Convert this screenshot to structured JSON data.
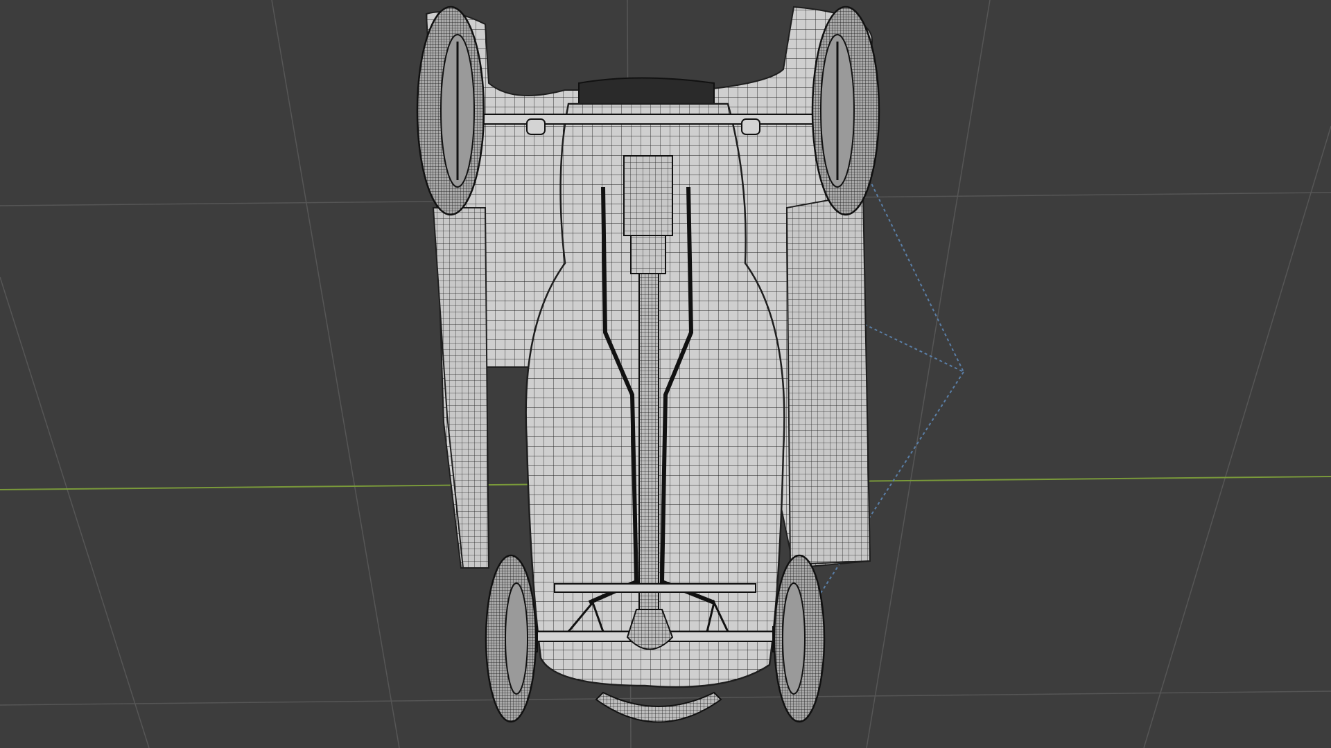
{
  "app": {
    "name": "3D viewport"
  },
  "viewport": {
    "view": "bottom",
    "shading": "wireframe",
    "object": "lawn-mower-mesh",
    "show_floor_grid": true,
    "show_x_axis": true,
    "show_camera_outline": true
  },
  "colors": {
    "background": "#3d3d3d",
    "grid_line": "#555555",
    "x_axis": "#7a9a3a",
    "mesh_fill": "#cfcfcf",
    "mesh_wire": "#1e1e1e",
    "camera_outline": "#5a7fa8"
  }
}
